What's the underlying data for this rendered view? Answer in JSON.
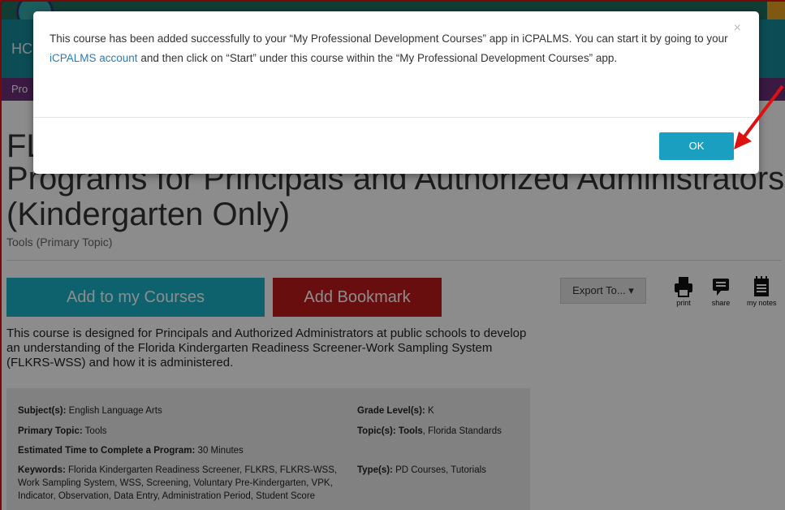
{
  "header": {
    "partial_text": "HC",
    "nav_partial": "Pro"
  },
  "course": {
    "title_line1": "FL",
    "title_line2": "Programs for Principals and Authorized Administrators",
    "title_line3": "(Kindergarten Only)",
    "primary_topic_label": "Tools (Primary Topic)",
    "add_button": "Add to my Courses",
    "bookmark_button": "Add Bookmark",
    "export_button": "Export To...",
    "tools": [
      {
        "label": "print",
        "icon": "printer-icon"
      },
      {
        "label": "share",
        "icon": "speech-bubble-icon"
      },
      {
        "label": "my notes",
        "icon": "notepad-icon"
      }
    ],
    "description": "This course is designed for Principals and Authorized Administrators at public schools to develop an understanding of the Florida Kindergarten Readiness Screener-Work Sampling System (FLKRS-WSS) and how it is administered."
  },
  "meta": {
    "subjects_label": "Subject(s):",
    "subjects_value": "English Language Arts",
    "grade_label": "Grade Level(s):",
    "grade_value": "K",
    "primary_label": "Primary Topic:",
    "primary_value": "Tools",
    "topics_label": "Topic(s):",
    "topics_bold": "Tools",
    "topics_rest": ", Florida Standards",
    "time_label": "Estimated Time to Complete a Program:",
    "time_value": "30 Minutes",
    "keywords_label": "Keywords:",
    "keywords_value": "Florida Kindergarten Readiness Screener, FLKRS, FLKRS-WSS, Work Sampling System, WSS, Screening, Voluntary Pre-Kindergarten, VPK, Indicator, Observation, Data Entry, Administration Period, Student Score",
    "types_label": "Type(s):",
    "types_value": "PD Courses, Tutorials"
  },
  "modal": {
    "message_before": "This course has been added successfully to your “My Professional Development Courses” app in iCPALMS. You can start it by going to your ",
    "link_text": "iCPALMS account",
    "message_after": " and then click on “Start” under this course within the “My Professional Development Courses” app.",
    "close": "×",
    "ok_label": "OK"
  },
  "colors": {
    "accent": "#1ab3c8",
    "bookmark": "#c01b1b",
    "ok": "#1a9fc0",
    "annotation": "#dd1111"
  }
}
